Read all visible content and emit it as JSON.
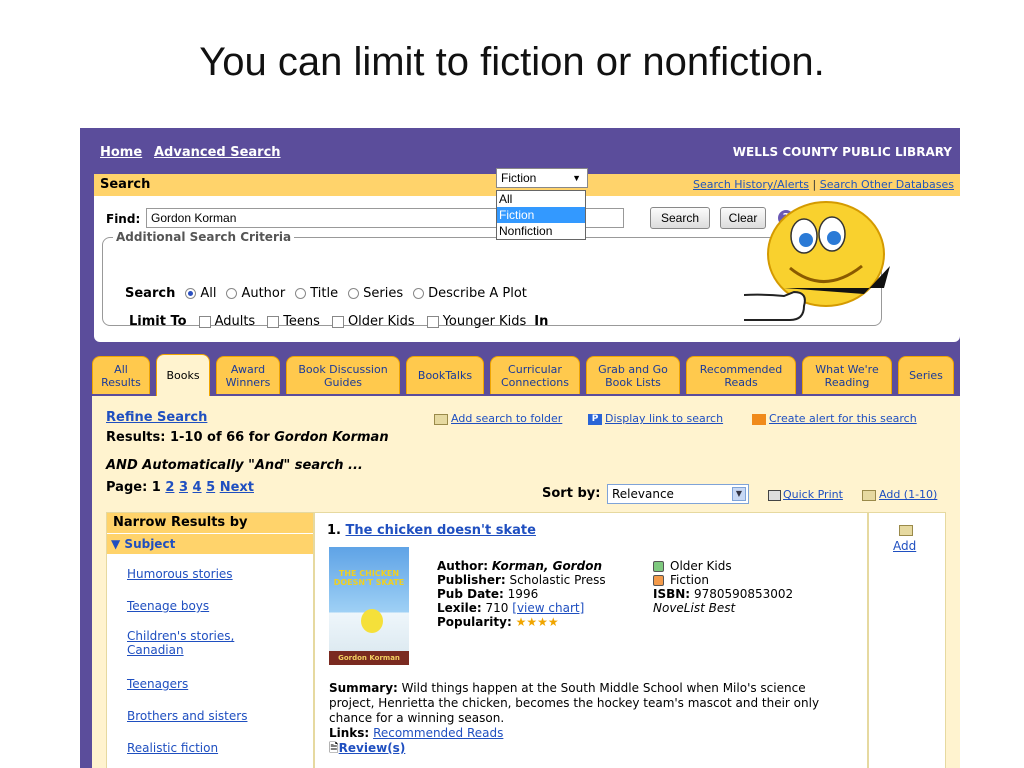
{
  "slide_title": "You can limit to fiction or nonfiction.",
  "topnav": {
    "home": "Home",
    "advanced": "Advanced Search",
    "library": "WELLS COUNTY PUBLIC LIBRARY"
  },
  "search": {
    "heading": "Search",
    "history_link": "Search History/Alerts",
    "separator": "|",
    "other_db_link": "Search Other Databases",
    "find_label": "Find:",
    "find_value": "Gordon Korman",
    "search_button": "Search",
    "clear_button": "Clear",
    "help_glyph": "?",
    "criteria_legend": "Additional Search Criteria",
    "search_label": "Search",
    "search_options": [
      "All",
      "Author",
      "Title",
      "Series",
      "Describe A Plot"
    ],
    "limit_label": "Limit To",
    "limit_options": [
      "Adults",
      "Teens",
      "Older Kids",
      "Younger Kids"
    ],
    "in_label": "In",
    "in_selected": "Fiction",
    "in_options": [
      "All",
      "Fiction",
      "Nonfiction"
    ]
  },
  "tabs": [
    {
      "label": "All Results"
    },
    {
      "label": "Books"
    },
    {
      "label": "Award Winners"
    },
    {
      "label": "Book Discussion Guides"
    },
    {
      "label": "BookTalks"
    },
    {
      "label": "Curricular Connections"
    },
    {
      "label": "Grab and Go Book Lists"
    },
    {
      "label": "Recommended Reads"
    },
    {
      "label": "What We're Reading"
    },
    {
      "label": "Series"
    }
  ],
  "results": {
    "refine": "Refine Search",
    "summary_prefix": "Results: 1-10 of 66 for ",
    "summary_query": "Gordon Korman",
    "auto_and": "AND Automatically \"And\" search ...",
    "page_label": "Page: 1",
    "pages": [
      "2",
      "3",
      "4",
      "5"
    ],
    "next": "Next",
    "add_folder": "Add search to folder",
    "display_link": "Display link to search",
    "create_alert": "Create alert for this search",
    "sort_label": "Sort by:",
    "sort_value": "Relevance",
    "quick_print": "Quick Print",
    "add_range": "Add (1-10)"
  },
  "narrow": {
    "heading": "Narrow Results by",
    "subject_heading": "Subject",
    "subjects": [
      "Humorous stories",
      "Teenage boys",
      "Children's stories, Canadian",
      "Teenagers",
      "Brothers and sisters",
      "Realistic fiction"
    ]
  },
  "record": {
    "number": "1.",
    "title": "The chicken doesn't skate",
    "cover_title": "THE CHICKEN DOESN'T SKATE",
    "cover_author": "Gordon Korman",
    "author_label": "Author:",
    "author": "Korman, Gordon",
    "publisher_label": "Publisher:",
    "publisher": "Scholastic Press",
    "pubdate_label": "Pub Date:",
    "pubdate": "1996",
    "lexile_label": "Lexile:",
    "lexile": "710",
    "lexile_link": "[view chart]",
    "popularity_label": "Popularity:",
    "popularity_stars": 4,
    "audience": "Older Kids",
    "genre": "Fiction",
    "isbn_label": "ISBN:",
    "isbn": "9780590853002",
    "novelist": "NoveList Best",
    "summary_label": "Summary:",
    "summary": "Wild things happen at the South Middle School when Milo's science project, Henrietta the chicken, becomes the hockey team's mascot and their only chance for a winning season.",
    "links_label": "Links:",
    "links_value": "Recommended Reads",
    "reviews": "Review(s)",
    "add": "Add"
  },
  "colors": {
    "frame": "#5b4d9b",
    "accent": "#ffd36b",
    "panel": "#fff3cf",
    "link": "#1f4fc0"
  }
}
